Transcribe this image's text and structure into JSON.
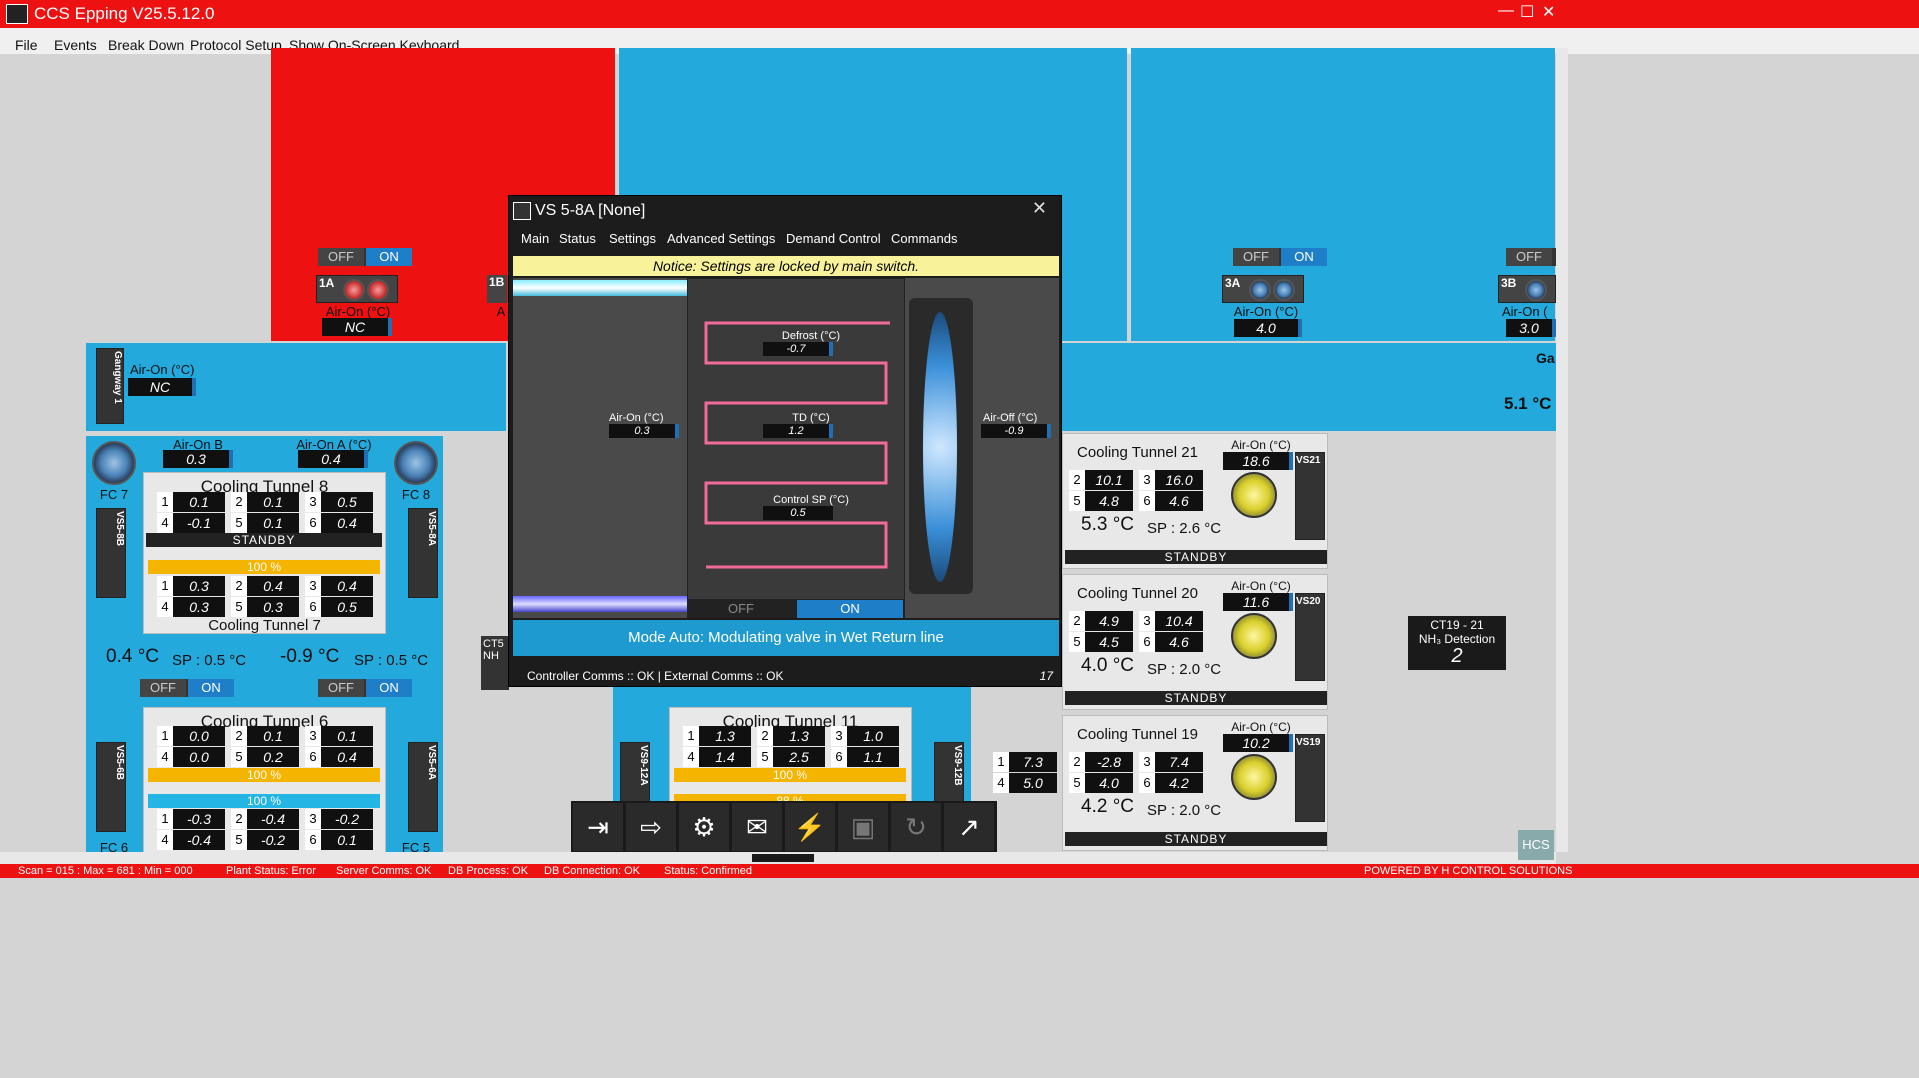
{
  "app": {
    "title": "CCS Epping V25.5.12.0"
  },
  "menu": [
    "File",
    "Events",
    "Break Down",
    "Protocol Setup",
    "Show On-Screen Keyboard"
  ],
  "room_toggle": {
    "off": "OFF",
    "on": "ON"
  },
  "room1a": {
    "tag": "1A",
    "label": "Air-On (°C)",
    "value": "NC"
  },
  "room1b": {
    "tag": "1B",
    "label": "A"
  },
  "room3a": {
    "tag": "3A",
    "label": "Air-On (°C)",
    "value": "4.0"
  },
  "room3b": {
    "tag": "3B",
    "label": "Air-On (",
    "value": "3.0"
  },
  "right_edge": {
    "ga": "Ga",
    "temp": "5.1 °C"
  },
  "gangway": {
    "tag": "Gangway 1",
    "label": "Air-On (°C)",
    "value": "NC"
  },
  "left_group": {
    "fc7": "FC 7",
    "fc8": "FC 8",
    "fc6": "FC 6",
    "fc5": "FC 5",
    "vs8b": "VS5-8B",
    "vs8a": "VS5-8A",
    "vs6b": "VS5-6B",
    "vs6a": "VS5-6A",
    "airon_b_label": "Air-On B (°C)",
    "airon_b": "0.3",
    "airon_a_label": "Air-On A (°C)",
    "airon_a": "0.4",
    "ct8": {
      "title": "Cooling Tunnel 8",
      "cells": [
        [
          "1",
          "0.1"
        ],
        [
          "2",
          "0.1"
        ],
        [
          "3",
          "0.5"
        ],
        [
          "4",
          "-0.1"
        ],
        [
          "5",
          "0.1"
        ],
        [
          "6",
          "0.4"
        ]
      ],
      "status": "STANDBY"
    },
    "ct7": {
      "title": "Cooling Tunnel 7",
      "bar": "100 %",
      "cells": [
        [
          "1",
          "0.3"
        ],
        [
          "2",
          "0.4"
        ],
        [
          "3",
          "0.4"
        ],
        [
          "4",
          "0.3"
        ],
        [
          "5",
          "0.3"
        ],
        [
          "6",
          "0.5"
        ]
      ]
    },
    "temp_left": "0.4 °C",
    "sp_left": "SP : 0.5 °C",
    "temp_right": "-0.9 °C",
    "sp_right": "SP : 0.5 °C",
    "ct6": {
      "title": "Cooling Tunnel 6",
      "cells": [
        [
          "1",
          "0.0"
        ],
        [
          "2",
          "0.1"
        ],
        [
          "3",
          "0.1"
        ],
        [
          "4",
          "0.0"
        ],
        [
          "5",
          "0.2"
        ],
        [
          "6",
          "0.4"
        ]
      ],
      "bar": "100 %"
    },
    "ct5": {
      "bar": "100 %",
      "cells": [
        [
          "1",
          "-0.3"
        ],
        [
          "2",
          "-0.4"
        ],
        [
          "3",
          "-0.2"
        ],
        [
          "4",
          "-0.4"
        ],
        [
          "5",
          "-0.2"
        ],
        [
          "6",
          "0.1"
        ]
      ]
    }
  },
  "ct11": {
    "title": "Cooling Tunnel 11",
    "cells": [
      [
        "1",
        "1.3"
      ],
      [
        "2",
        "1.3"
      ],
      [
        "3",
        "1.0"
      ],
      [
        "4",
        "1.4"
      ],
      [
        "5",
        "2.5"
      ],
      [
        "6",
        "1.1"
      ]
    ],
    "bar": "100 %",
    "bar2": "88 %",
    "vs_left": "VS9-12A",
    "vs_right": "VS9-12B"
  },
  "ct_partial": {
    "label": "CT5",
    "label2": "NH"
  },
  "right_tunnels": [
    {
      "title": "Cooling Tunnel 21",
      "airon_label": "Air-On (°C)",
      "airon": "18.6",
      "vs": "VS21",
      "cells": [
        [
          "2",
          "10.1"
        ],
        [
          "3",
          "16.0"
        ],
        [
          "5",
          "4.8"
        ],
        [
          "6",
          "4.6"
        ]
      ],
      "temp": "5.3 °C",
      "sp": "SP : 2.6 °C",
      "status": "STANDBY"
    },
    {
      "title": "Cooling Tunnel 20",
      "airon_label": "Air-On (°C)",
      "airon": "11.6",
      "vs": "VS20",
      "cells": [
        [
          "2",
          "4.9"
        ],
        [
          "3",
          "10.4"
        ],
        [
          "5",
          "4.5"
        ],
        [
          "6",
          "4.6"
        ]
      ],
      "temp": "4.0 °C",
      "sp": "SP : 2.0 °C",
      "status": "STANDBY"
    },
    {
      "title": "Cooling Tunnel 19",
      "airon_label": "Air-On (°C)",
      "airon": "10.2",
      "vs": "VS19",
      "cells": [
        [
          "1",
          "7.3"
        ],
        [
          "2",
          "-2.8"
        ],
        [
          "3",
          "7.4"
        ],
        [
          "4",
          "5.0"
        ],
        [
          "5",
          "4.0"
        ],
        [
          "6",
          "4.2"
        ]
      ],
      "temp": "4.2 °C",
      "sp": "SP : 2.0 °C",
      "status": "STANDBY"
    }
  ],
  "nh3": {
    "title": "CT19 - 21",
    "subtitle": "NH₃ Detection",
    "value": "2"
  },
  "dialog": {
    "title": "VS 5-8A [None]",
    "tabs": [
      "Main",
      "Status",
      "Settings",
      "Advanced Settings",
      "Demand Control",
      "Commands"
    ],
    "notice": "Notice: Settings are locked by main switch.",
    "defrost_label": "Defrost (°C)",
    "defrost": "-0.7",
    "td_label": "TD (°C)",
    "td": "1.2",
    "control_sp_label": "Control SP (°C)",
    "control_sp": "0.5",
    "airon_label": "Air-On (°C)",
    "airon": "0.3",
    "airoff_label": "Air-Off (°C)",
    "airoff": "-0.9",
    "off": "OFF",
    "on": "ON",
    "mode": "Mode Auto: Modulating valve in Wet Return line",
    "comms": "Controller Comms :: OK | External Comms :: OK",
    "count": "17"
  },
  "statusbar": {
    "scan": "Scan = 015 : Max = 681 : Min = 000",
    "plant": "Plant Status: Error",
    "server": "Server Comms: OK",
    "dbproc": "DB Process:  OK",
    "dbconn": "DB Connection:  OK",
    "status": "Status:  Confirmed",
    "powered": "POWERED BY H CONTROL SOLUTIONS"
  },
  "hcs": "HCS",
  "colors": {
    "alarm": "#ee1111",
    "cyan": "#23a9dc",
    "accent": "#1e7fc8",
    "yellow": "#f4b400"
  }
}
